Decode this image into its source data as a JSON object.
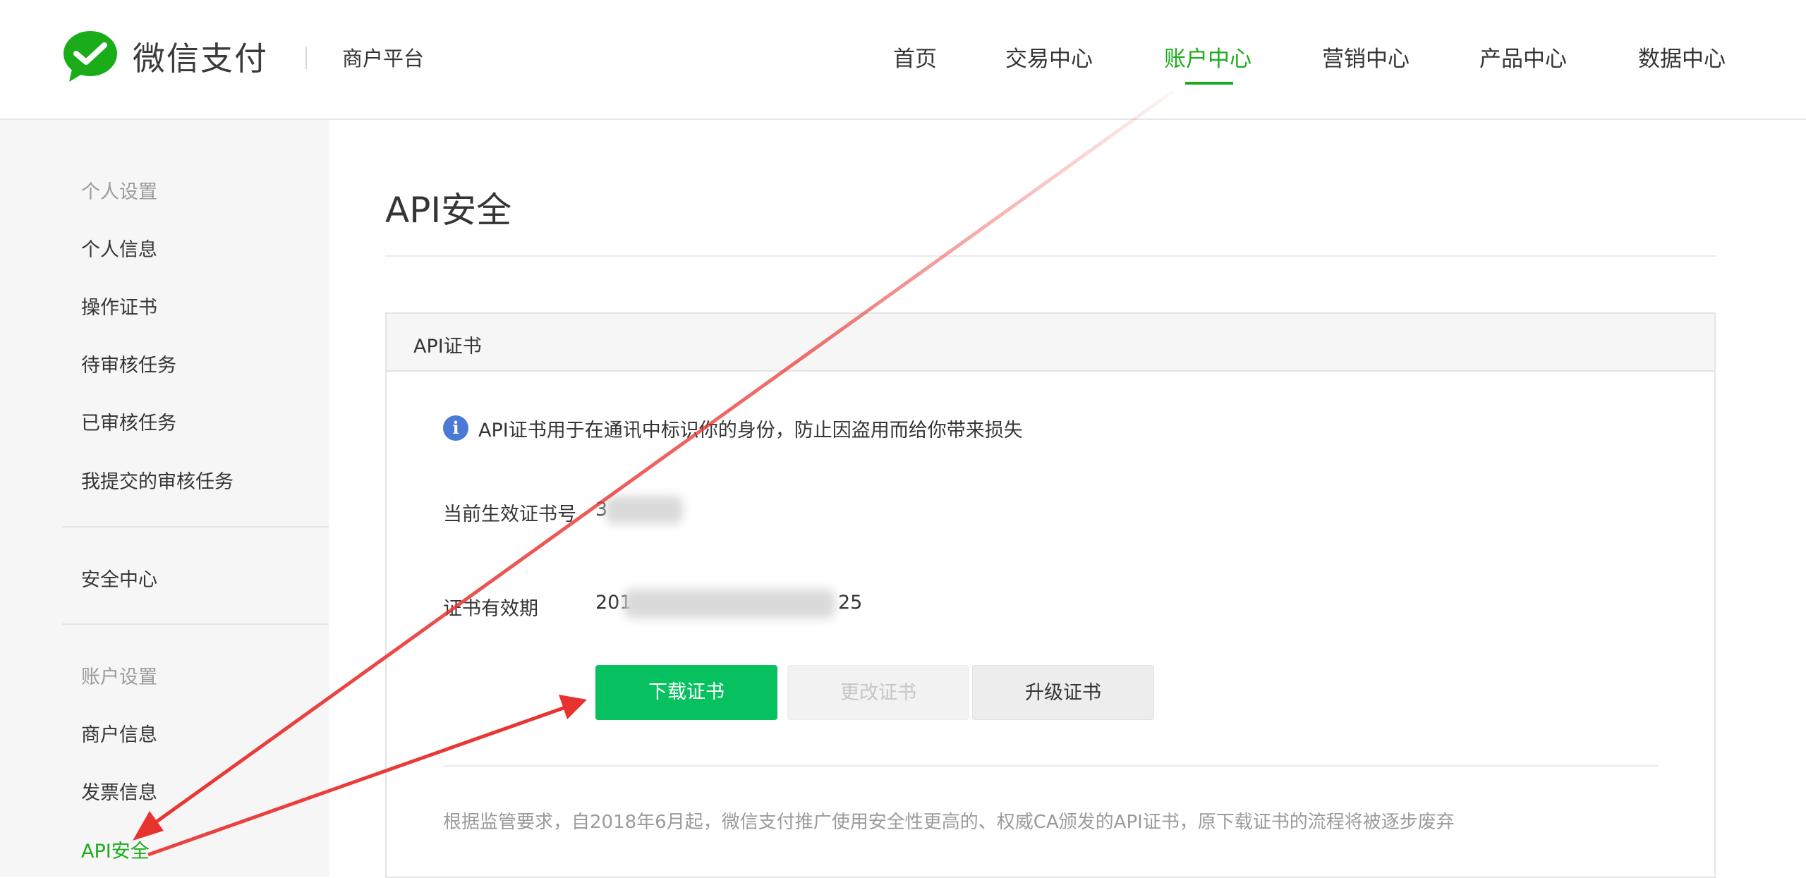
{
  "header": {
    "brand_name": "微信支付",
    "platform_name": "商户平台",
    "nav": [
      {
        "label": "首页",
        "active": false
      },
      {
        "label": "交易中心",
        "active": false
      },
      {
        "label": "账户中心",
        "active": true
      },
      {
        "label": "营销中心",
        "active": false
      },
      {
        "label": "产品中心",
        "active": false
      },
      {
        "label": "数据中心",
        "active": false
      }
    ]
  },
  "sidebar": {
    "groups": [
      {
        "title": "个人设置",
        "items": [
          {
            "label": "个人信息",
            "active": false
          },
          {
            "label": "操作证书",
            "active": false
          },
          {
            "label": "待审核任务",
            "active": false
          },
          {
            "label": "已审核任务",
            "active": false
          },
          {
            "label": "我提交的审核任务",
            "active": false
          }
        ]
      },
      {
        "title": "",
        "items": [
          {
            "label": "安全中心",
            "active": false
          }
        ]
      },
      {
        "title": "账户设置",
        "items": [
          {
            "label": "商户信息",
            "active": false
          },
          {
            "label": "发票信息",
            "active": false
          },
          {
            "label": "API安全",
            "active": true
          }
        ]
      }
    ]
  },
  "main": {
    "page_title": "API安全",
    "panel": {
      "title": "API证书",
      "info_text": "API证书用于在通讯中标识你的身份，防止因盗用而给你带来损失",
      "cert_number_label": "当前生效证书号",
      "cert_number_visible_prefix": "3",
      "validity_label": "证书有效期",
      "validity_visible_prefix": "201",
      "validity_visible_suffix": "25",
      "buttons": {
        "download": "下载证书",
        "change": "更改证书",
        "upgrade": "升级证书"
      },
      "footnote": "根据监管要求，自2018年6月起，微信支付推广使用安全性更高的、权威CA颁发的API证书，原下载证书的流程将被逐步废弃"
    }
  },
  "colors": {
    "brand_green": "#1aad19",
    "button_green": "#07c160",
    "annotation_red": "#e8322f",
    "info_blue": "#4a7ad6"
  },
  "icons": {
    "logo": "wechat-pay-logo-icon",
    "info": "info-icon"
  }
}
